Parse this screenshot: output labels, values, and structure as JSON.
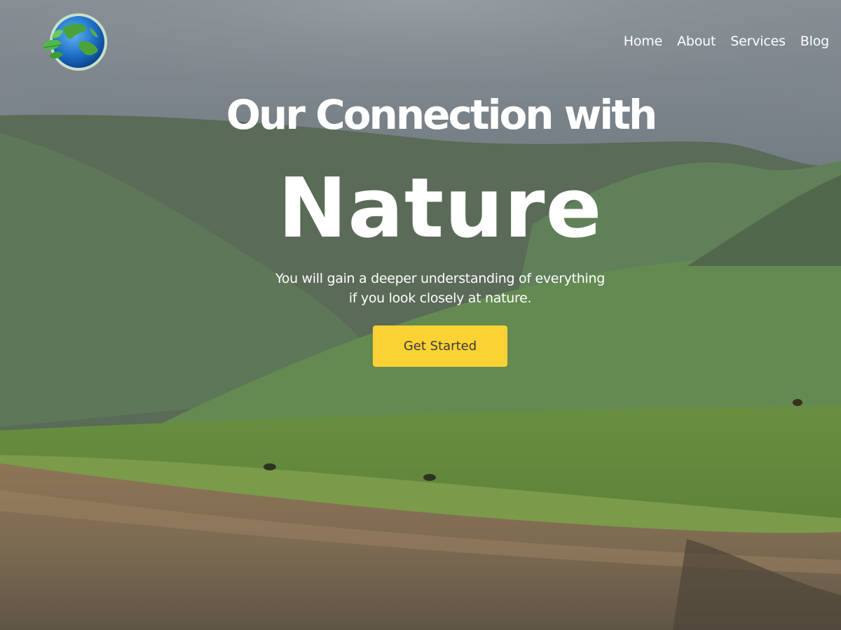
{
  "nav": {
    "items": [
      {
        "label": "Home"
      },
      {
        "label": "About"
      },
      {
        "label": "Services"
      },
      {
        "label": "Blog"
      }
    ]
  },
  "hero": {
    "headline_top": "Our Connection with",
    "headline_main": "Nature",
    "subtitle_line1": "You will gain a deeper understanding of everything",
    "subtitle_line2": "if you look closely at nature.",
    "cta_label": "Get Started"
  },
  "icons": {
    "logo": "earth-globe-with-leaves-icon"
  },
  "colors": {
    "cta_background": "#fbd234",
    "cta_text": "#3a3a3a",
    "text": "#ffffff",
    "sky": "#6f7880",
    "hills": "#5f7a5a",
    "meadow": "#6f9a45",
    "cliff": "#8a7358"
  }
}
